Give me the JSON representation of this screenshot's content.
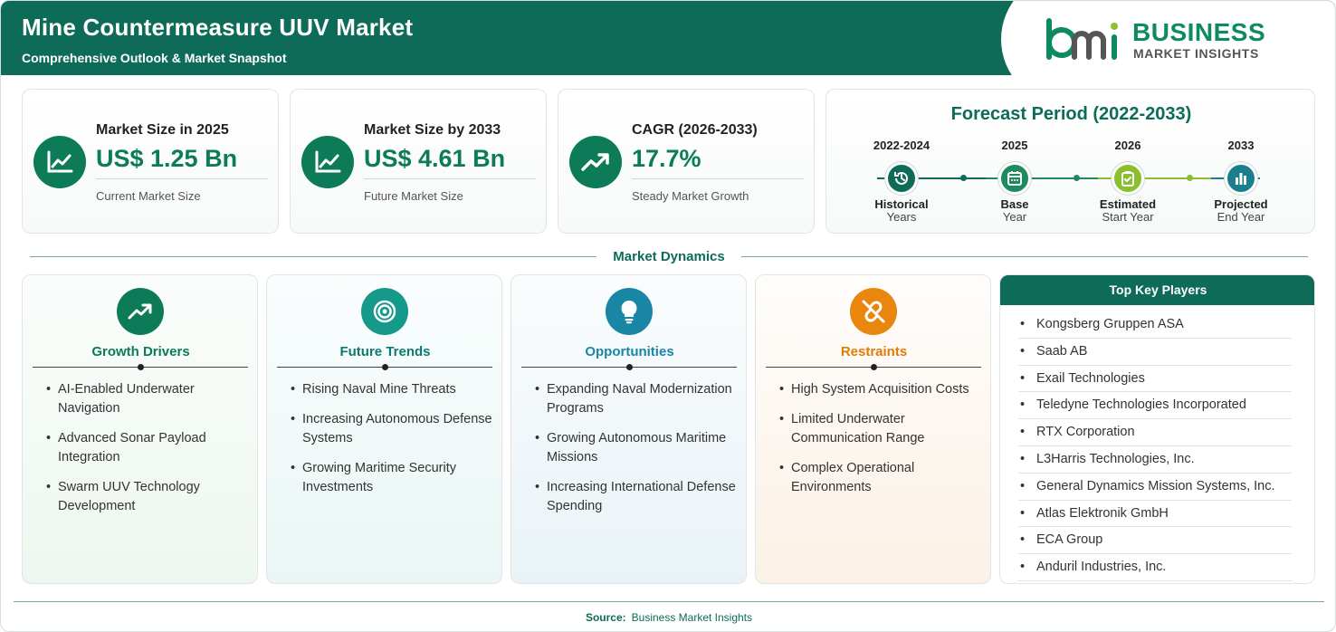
{
  "header": {
    "title": "Mine Countermeasure UUV Market",
    "subtitle": "Comprehensive Outlook & Market Snapshot",
    "logo_line1": "BUSINESS",
    "logo_line2": "MARKET INSIGHTS",
    "logo_mark_text": "bmi"
  },
  "stats": [
    {
      "label": "Market Size in 2025",
      "value": "US$ 1.25 Bn",
      "note": "Current Market Size",
      "icon": "line-chart-icon"
    },
    {
      "label": "Market Size by 2033",
      "value": "US$ 4.61 Bn",
      "note": "Future Market Size",
      "icon": "line-chart-icon"
    },
    {
      "label": "CAGR (2026-2033)",
      "value": "17.7%",
      "note": "Steady Market Growth",
      "icon": "trend-up-icon"
    }
  ],
  "forecast": {
    "title": "Forecast Period (2022-2033)",
    "steps": [
      {
        "year": "2022-2024",
        "line1": "Historical",
        "line2": "Years",
        "color": "#0d6b58",
        "icon": "history-icon"
      },
      {
        "year": "2025",
        "line1": "Base",
        "line2": "Year",
        "color": "#1e8a5e",
        "icon": "calendar-icon"
      },
      {
        "year": "2026",
        "line1": "Estimated",
        "line2": "Start Year",
        "color": "#8cbf2e",
        "icon": "clipboard-check-icon"
      },
      {
        "year": "2033",
        "line1": "Projected",
        "line2": "End Year",
        "color": "#1a7f8c",
        "icon": "bar-chart-icon"
      }
    ]
  },
  "dynamics": {
    "title": "Market Dynamics",
    "cards": [
      {
        "title": "Growth Drivers",
        "color": "#0d7a58",
        "icon": "trend-up-icon",
        "items": [
          "AI-Enabled Underwater Navigation",
          "Advanced Sonar Payload Integration",
          "Swarm UUV Technology Development"
        ]
      },
      {
        "title": "Future Trends",
        "color": "#15998a",
        "icon": "target-icon",
        "items": [
          "Rising Naval Mine Threats",
          "Increasing Autonomous Defense Systems",
          "Growing Maritime Security Investments"
        ]
      },
      {
        "title": "Opportunities",
        "color": "#1a86a6",
        "icon": "lightbulb-icon",
        "items": [
          "Expanding Naval Modernization Programs",
          "Growing Autonomous Maritime Missions",
          "Increasing International Defense Spending"
        ]
      },
      {
        "title": "Restraints",
        "color": "#e8860e",
        "icon": "broken-link-icon",
        "items": [
          "High System Acquisition Costs",
          "Limited Underwater Communication Range",
          "Complex Operational Environments"
        ]
      }
    ]
  },
  "players": {
    "title": "Top Key Players",
    "items": [
      "Kongsberg Gruppen ASA",
      "Saab AB",
      "Exail Technologies",
      "Teledyne Technologies Incorporated",
      "RTX Corporation",
      "L3Harris Technologies, Inc.",
      "General Dynamics Mission Systems, Inc.",
      "Atlas Elektronik GmbH",
      "ECA Group",
      "Anduril Industries, Inc."
    ]
  },
  "footer": {
    "source_label": "Source:",
    "source_value": "Business Market Insights"
  }
}
